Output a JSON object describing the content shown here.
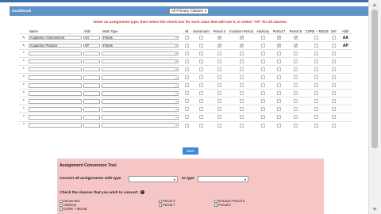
{
  "header": {
    "section_title": "Gradebook",
    "class_select": "All Primary Classes"
  },
  "instruction": "Enter an assignment type, then select the check box for each class that will use it, or select \"All\" for all classes.",
  "columns": [
    "Name",
    "Abbr",
    "Mark Type",
    "All",
    "Homeroom",
    "Period 4",
    "Inclusion Period 5",
    "Advisory",
    "Period 7",
    "Period 8",
    "CORE + MOUE",
    "Def",
    "Abbr"
  ],
  "rows": [
    {
      "name": "Academic Achievement",
      "abbr": "AA",
      "mark": "Points",
      "checks": [
        false,
        false,
        true,
        true,
        false,
        true,
        true,
        false,
        false
      ],
      "row_abbr": "AA"
    },
    {
      "name": "Academic Practice",
      "abbr": "AP",
      "mark": "Points",
      "checks": [
        false,
        false,
        true,
        true,
        false,
        true,
        true,
        false,
        false
      ],
      "row_abbr": "AP"
    },
    {
      "name": "",
      "abbr": "",
      "mark": "",
      "checks": [
        false,
        false,
        false,
        false,
        false,
        false,
        false,
        false,
        false
      ],
      "row_abbr": ""
    },
    {
      "name": "",
      "abbr": "",
      "mark": "",
      "checks": [
        false,
        false,
        false,
        false,
        false,
        false,
        false,
        false,
        false
      ],
      "row_abbr": ""
    },
    {
      "name": "",
      "abbr": "",
      "mark": "",
      "checks": [
        false,
        false,
        false,
        false,
        false,
        false,
        false,
        false,
        false
      ],
      "row_abbr": ""
    },
    {
      "name": "",
      "abbr": "",
      "mark": "",
      "checks": [
        false,
        false,
        false,
        false,
        false,
        false,
        false,
        false,
        false
      ],
      "row_abbr": ""
    },
    {
      "name": "",
      "abbr": "",
      "mark": "",
      "checks": [
        false,
        false,
        false,
        false,
        false,
        false,
        false,
        false,
        false
      ],
      "row_abbr": ""
    },
    {
      "name": "",
      "abbr": "",
      "mark": "",
      "checks": [
        false,
        false,
        false,
        false,
        false,
        false,
        false,
        false,
        false
      ],
      "row_abbr": ""
    },
    {
      "name": "",
      "abbr": "",
      "mark": "",
      "checks": [
        false,
        false,
        false,
        false,
        false,
        false,
        false,
        false,
        false
      ],
      "row_abbr": ""
    },
    {
      "name": "",
      "abbr": "",
      "mark": "",
      "checks": [
        false,
        false,
        false,
        false,
        false,
        false,
        false,
        false,
        false
      ],
      "row_abbr": ""
    },
    {
      "name": "",
      "abbr": "",
      "mark": "",
      "checks": [
        false,
        false,
        false,
        false,
        false,
        false,
        false,
        false,
        false
      ],
      "row_abbr": ""
    },
    {
      "name": "",
      "abbr": "",
      "mark": "",
      "checks": [
        false,
        false,
        false,
        false,
        false,
        false,
        false,
        false,
        false
      ],
      "row_abbr": ""
    }
  ],
  "save_label": "Save",
  "conversion": {
    "title": "Assignment Conversion Tool",
    "convert_label": "Convert all assignments with type",
    "to_type_label": "to type",
    "check_label": "Check the classes that you wish to convert:",
    "classes": [
      "Homeroom",
      "Advisory",
      "CORE + MOUE",
      "Period 4",
      "Period 7",
      "Inclusion Period 5",
      "Period 8"
    ]
  },
  "colors": {
    "header_blue": "#5f93c8",
    "instruction_red": "#c0392b",
    "tool_bg": "#f6c6c6",
    "save_blue": "#3d8bd6"
  }
}
